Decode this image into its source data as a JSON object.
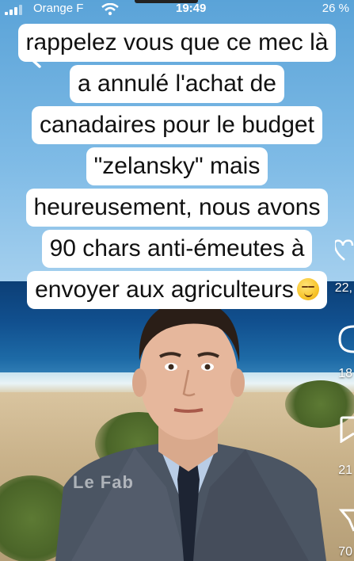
{
  "status_bar": {
    "carrier": "Orange F",
    "time": "19:49",
    "battery": "26 %"
  },
  "caption": {
    "lines": [
      "rappelez vous que ce mec là",
      "a annulé l'achat de",
      "canadaires pour le budget",
      "\"zelansky\" mais",
      "heureusement, nous avons",
      "90 chars anti-émeutes à",
      "envoyer aux agriculteurs"
    ]
  },
  "video": {
    "watermark": "Le Fab"
  },
  "right_rail": {
    "like_count": "22,",
    "comment_count": "18",
    "save_count": "21",
    "share_count": "70"
  },
  "icons": {
    "back": "chevron-left-icon",
    "like": "heart-icon",
    "comment": "comment-icon",
    "save": "bookmark-icon",
    "share": "share-icon",
    "emoji": "smirking-face-emoji"
  }
}
